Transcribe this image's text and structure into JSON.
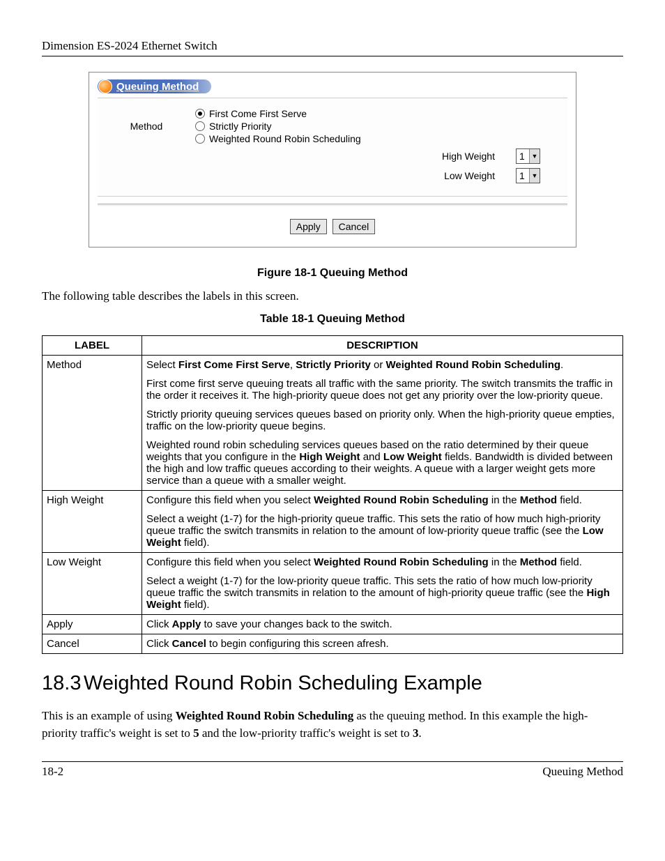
{
  "header": {
    "title": "Dimension ES-2024 Ethernet Switch"
  },
  "screenshot": {
    "panelTitle": "Queuing Method",
    "methodLabel": "Method",
    "options": {
      "o1": "First Come First Serve",
      "o2": "Strictly Priority",
      "o3": "Weighted Round Robin Scheduling"
    },
    "highWeightLabel": "High Weight",
    "lowWeightLabel": "Low Weight",
    "highWeightValue": "1",
    "lowWeightValue": "1",
    "applyBtn": "Apply",
    "cancelBtn": "Cancel"
  },
  "captions": {
    "figure": "Figure 18-1 Queuing Method",
    "intro": "The following table describes the labels in this screen.",
    "table": "Table 18-1 Queuing Method"
  },
  "tableHeaders": {
    "label": "LABEL",
    "desc": "DESCRIPTION"
  },
  "rows": {
    "r1label": "Method",
    "r1a_pre": "Select ",
    "r1a_b1": "First Come First Serve",
    "r1a_mid1": ", ",
    "r1a_b2": "Strictly Priority",
    "r1a_mid2": " or ",
    "r1a_b3": "Weighted Round Robin Scheduling",
    "r1a_post": ".",
    "r1b": "First come first serve queuing treats all traffic with the same priority. The switch transmits the traffic in the order it receives it. The high-priority queue does not get any priority over the low-priority queue.",
    "r1c": "Strictly priority queuing services queues based on priority only. When the high-priority queue empties, traffic on the low-priority queue begins.",
    "r1d_pre": "Weighted round robin scheduling services queues based on the ratio determined by their queue weights that you configure in the ",
    "r1d_b1": "High Weight",
    "r1d_mid": " and ",
    "r1d_b2": "Low Weight",
    "r1d_post": " fields. Bandwidth is divided between the high and low traffic queues according to their weights. A queue with a larger weight gets more service than a queue with a smaller weight.",
    "r2label": "High Weight",
    "r2a_pre": "Configure this field when you select ",
    "r2a_b1": "Weighted Round Robin Scheduling",
    "r2a_mid": " in the ",
    "r2a_b2": "Method",
    "r2a_post": " field.",
    "r2b_pre": "Select a weight (1-7) for the high-priority queue traffic. This sets the ratio of how much high-priority queue traffic the switch transmits in relation to the amount of low-priority queue traffic (see the ",
    "r2b_b1": "Low Weight",
    "r2b_post": " field).",
    "r3label": "Low Weight",
    "r3a_pre": "Configure this field when you select ",
    "r3a_b1": "Weighted Round Robin Scheduling",
    "r3a_mid": " in the ",
    "r3a_b2": "Method",
    "r3a_post": " field.",
    "r3b_pre": "Select a weight (1-7) for the low-priority queue traffic. This sets the ratio of how much low-priority queue traffic the switch transmits in relation to the amount of high-priority queue traffic (see the ",
    "r3b_b1": "High Weight",
    "r3b_post": " field).",
    "r4label": "Apply",
    "r4_pre": "Click ",
    "r4_b1": "Apply",
    "r4_post": " to save your changes back to the switch.",
    "r5label": "Cancel",
    "r5_pre": "Click ",
    "r5_b1": "Cancel",
    "r5_post": " to begin configuring this screen afresh."
  },
  "section": {
    "num": "18.3",
    "title": "Weighted Round Robin Scheduling Example",
    "para_pre": "This is an example of using ",
    "para_b1": "Weighted Round Robin Scheduling",
    "para_mid1": " as the queuing method. In this example the high-priority traffic's weight is set to ",
    "para_b2": "5",
    "para_mid2": " and the low-priority traffic's weight is set to ",
    "para_b3": "3",
    "para_post": "."
  },
  "footer": {
    "left": "18-2",
    "right": "Queuing Method"
  }
}
